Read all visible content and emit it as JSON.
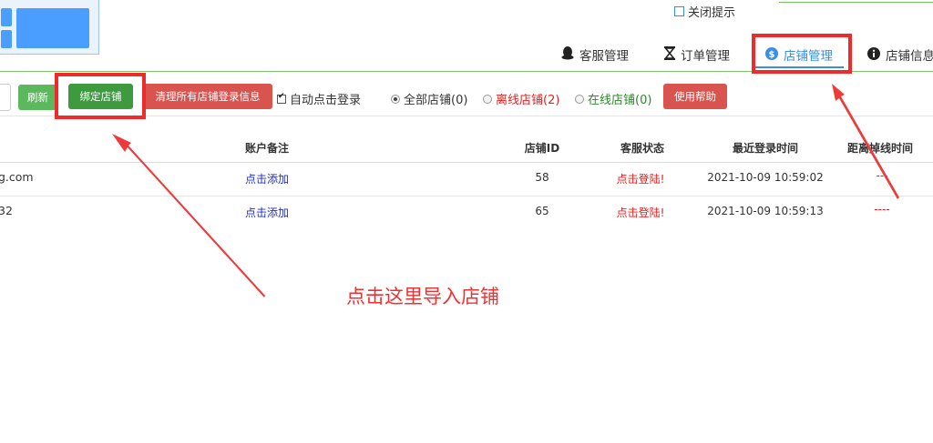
{
  "header": {
    "close_tip_label": "关闭提示"
  },
  "nav": {
    "tabs": [
      {
        "label": "客服管理",
        "icon": "qq-penguin-icon"
      },
      {
        "label": "订单管理",
        "icon": "hourglass-icon"
      },
      {
        "label": "店铺管理",
        "icon": "dollar-circle-icon",
        "active": true
      },
      {
        "label": "店铺信息",
        "icon": "info-circle-icon"
      }
    ]
  },
  "toolbar": {
    "refresh_label": "刷新",
    "bind_store_label": "绑定店铺",
    "clear_login_label": "清理所有店铺登录信息",
    "auto_login_label": "自动点击登录",
    "filter_all_label": "全部店铺(0)",
    "filter_offline_label": "离线店铺(2)",
    "filter_online_label": "在线店铺(0)",
    "help_label": "使用帮助"
  },
  "table": {
    "columns": [
      "账户备注",
      "店铺ID",
      "客服状态",
      "最近登录时间",
      "距离掉线时间"
    ],
    "rows": [
      {
        "account": "g.com",
        "remark": "点击添加",
        "store_id": "58",
        "status": "点击登陆!",
        "last_login": "2021-10-09 10:59:02",
        "offline_in": "---"
      },
      {
        "account": "32",
        "remark": "点击添加",
        "store_id": "65",
        "status": "点击登陆!",
        "last_login": "2021-10-09 10:59:13",
        "offline_in": "----"
      }
    ]
  },
  "annotation": {
    "text": "点击这里导入店铺"
  },
  "colors": {
    "accent_blue": "#3a8ee6",
    "button_green": "#5cb85c",
    "button_dark_green": "#3e9a3e",
    "button_red": "#d9534f",
    "annotation_red": "#ee2a2a",
    "link_blue": "#2030d0"
  }
}
